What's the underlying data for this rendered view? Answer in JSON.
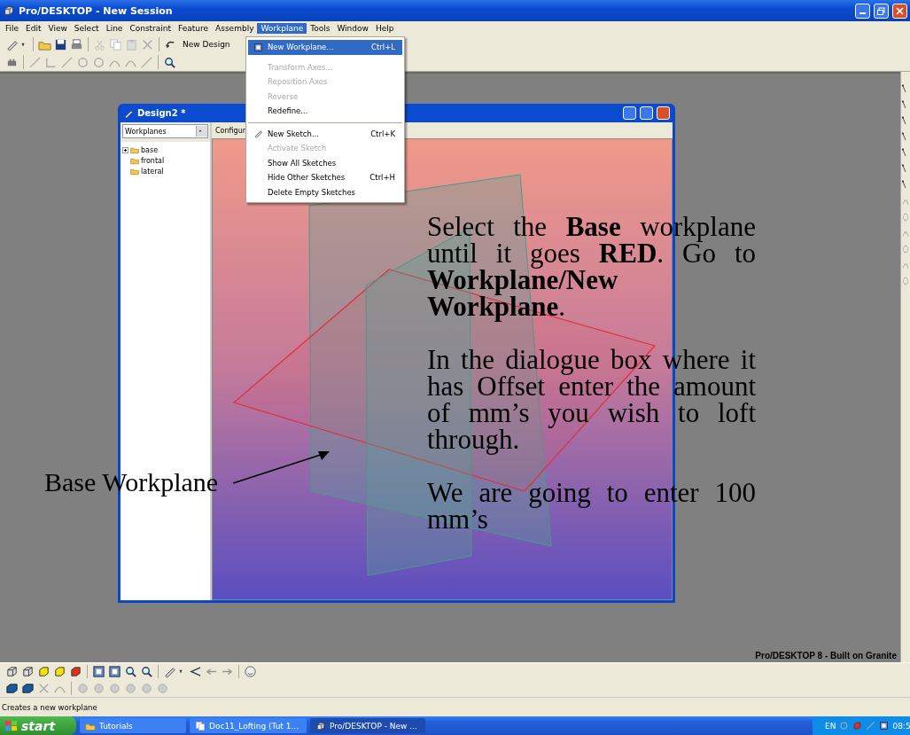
{
  "app_window": {
    "title": "Pro/DESKTOP - New Session"
  },
  "menu_bar": [
    {
      "label": "File",
      "selected": false
    },
    {
      "label": "Edit",
      "selected": false
    },
    {
      "label": "View",
      "selected": false
    },
    {
      "label": "Select",
      "selected": false
    },
    {
      "label": "Line",
      "selected": false
    },
    {
      "label": "Constraint",
      "selected": false
    },
    {
      "label": "Feature",
      "selected": false
    },
    {
      "label": "Assembly",
      "selected": false
    },
    {
      "label": "Workplane",
      "selected": true
    },
    {
      "label": "Tools",
      "selected": false
    },
    {
      "label": "Window",
      "selected": false
    },
    {
      "label": "Help",
      "selected": false
    }
  ],
  "toolbar": {
    "design_button": "New Design"
  },
  "workplane_menu": {
    "items": [
      {
        "kind": "item",
        "label": "New Workplane...",
        "shortcut": "Ctrl+L",
        "selected": true,
        "disabled": false
      },
      {
        "kind": "item",
        "label": "Transform Axes...",
        "selected": false,
        "disabled": true
      },
      {
        "kind": "item",
        "label": "Reposition Axes",
        "selected": false,
        "disabled": true
      },
      {
        "kind": "item",
        "label": "Reverse",
        "selected": false,
        "disabled": true
      },
      {
        "kind": "item",
        "label": "Redefine...",
        "selected": false,
        "disabled": false
      },
      {
        "kind": "separator"
      },
      {
        "kind": "item",
        "label": "New Sketch...",
        "shortcut": "Ctrl+K",
        "selected": false,
        "disabled": false
      },
      {
        "kind": "item",
        "label": "Activate Sketch",
        "selected": false,
        "disabled": true
      },
      {
        "kind": "item",
        "label": "Show All Sketches",
        "selected": false,
        "disabled": false
      },
      {
        "kind": "item",
        "label": "Hide Other Sketches",
        "shortcut": "Ctrl+H",
        "selected": false,
        "disabled": false
      },
      {
        "kind": "item",
        "label": "Delete Empty Sketches",
        "selected": false,
        "disabled": false
      }
    ]
  },
  "design_window": {
    "title": "Design2 *",
    "view_select": "Workplanes",
    "toolbar_label": "Configur",
    "tree": [
      {
        "label": "base",
        "collapsed": true
      },
      {
        "label": "frontal",
        "collapsed": false
      },
      {
        "label": "lateral",
        "collapsed": false
      }
    ]
  },
  "instructions": {
    "paragraphs": [
      "Select the **Base** workplane until it goes **RED**. Go to **Workplane/New Workplane**.",
      "In the dialogue box where it has Offset enter the amount of mm’s you wish to loft through.",
      "We are going to enter 100 mm’s"
    ]
  },
  "callout": {
    "label": "Base Workplane"
  },
  "brand_label": "Pro/DESKTOP 8 - Built on Granite",
  "status_message": "Creates a new workplane",
  "taskbar": {
    "start": "start",
    "tasks": [
      {
        "label": "Tutorials",
        "selected": false
      },
      {
        "label": "Doc11_Lofting (Tut 1...",
        "selected": false
      },
      {
        "label": "Pro/DESKTOP - New ...",
        "selected": true
      }
    ],
    "language": "EN",
    "clock": "08:5"
  }
}
